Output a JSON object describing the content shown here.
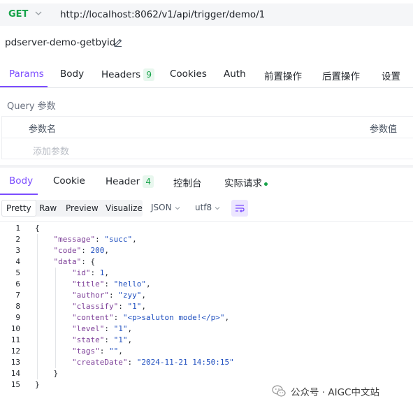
{
  "request": {
    "method": "GET",
    "url": "http://localhost:8062/v1/api/trigger/demo/1",
    "name": "pdserver-demo-getbyid"
  },
  "request_tabs": [
    {
      "label": "Params",
      "active": true
    },
    {
      "label": "Body"
    },
    {
      "label": "Headers",
      "badge": "9"
    },
    {
      "label": "Cookies"
    },
    {
      "label": "Auth"
    },
    {
      "label": "前置操作"
    },
    {
      "label": "后置操作"
    },
    {
      "label": "设置"
    }
  ],
  "query": {
    "section_label": "Query 参数",
    "name_header": "参数名",
    "value_header": "参数值",
    "add_placeholder": "添加参数"
  },
  "response_tabs": [
    {
      "label": "Body",
      "active": true
    },
    {
      "label": "Cookie"
    },
    {
      "label": "Header",
      "badge": "4"
    },
    {
      "label": "控制台"
    },
    {
      "label": "实际请求"
    }
  ],
  "format_toolbar": {
    "modes": [
      "Pretty",
      "Raw",
      "Preview",
      "Visualize"
    ],
    "active_mode": "Pretty",
    "language": "JSON",
    "encoding": "utf8"
  },
  "code_lines": [
    {
      "n": "1",
      "indent": 0,
      "parts": [
        [
          "p",
          "{"
        ]
      ]
    },
    {
      "n": "2",
      "indent": 1,
      "parts": [
        [
          "k",
          "\"message\""
        ],
        [
          "p",
          ": "
        ],
        [
          "s",
          "\"succ\""
        ],
        [
          "p",
          ","
        ]
      ]
    },
    {
      "n": "3",
      "indent": 1,
      "parts": [
        [
          "k",
          "\"code\""
        ],
        [
          "p",
          ": "
        ],
        [
          "n",
          "200"
        ],
        [
          "p",
          ","
        ]
      ]
    },
    {
      "n": "4",
      "indent": 1,
      "parts": [
        [
          "k",
          "\"data\""
        ],
        [
          "p",
          ": {"
        ]
      ]
    },
    {
      "n": "5",
      "indent": 2,
      "parts": [
        [
          "k",
          "\"id\""
        ],
        [
          "p",
          ": "
        ],
        [
          "n",
          "1"
        ],
        [
          "p",
          ","
        ]
      ]
    },
    {
      "n": "6",
      "indent": 2,
      "parts": [
        [
          "k",
          "\"title\""
        ],
        [
          "p",
          ": "
        ],
        [
          "s",
          "\"hello\""
        ],
        [
          "p",
          ","
        ]
      ]
    },
    {
      "n": "7",
      "indent": 2,
      "parts": [
        [
          "k",
          "\"author\""
        ],
        [
          "p",
          ": "
        ],
        [
          "s",
          "\"zyy\""
        ],
        [
          "p",
          ","
        ]
      ]
    },
    {
      "n": "8",
      "indent": 2,
      "parts": [
        [
          "k",
          "\"classify\""
        ],
        [
          "p",
          ": "
        ],
        [
          "s",
          "\"1\""
        ],
        [
          "p",
          ","
        ]
      ]
    },
    {
      "n": "9",
      "indent": 2,
      "parts": [
        [
          "k",
          "\"content\""
        ],
        [
          "p",
          ": "
        ],
        [
          "s",
          "\"<p>saluton mode!</p>\""
        ],
        [
          "p",
          ","
        ]
      ]
    },
    {
      "n": "10",
      "indent": 2,
      "parts": [
        [
          "k",
          "\"level\""
        ],
        [
          "p",
          ": "
        ],
        [
          "s",
          "\"1\""
        ],
        [
          "p",
          ","
        ]
      ]
    },
    {
      "n": "11",
      "indent": 2,
      "parts": [
        [
          "k",
          "\"state\""
        ],
        [
          "p",
          ": "
        ],
        [
          "s",
          "\"1\""
        ],
        [
          "p",
          ","
        ]
      ]
    },
    {
      "n": "12",
      "indent": 2,
      "parts": [
        [
          "k",
          "\"tags\""
        ],
        [
          "p",
          ": "
        ],
        [
          "s",
          "\"\""
        ],
        [
          "p",
          ","
        ]
      ]
    },
    {
      "n": "13",
      "indent": 2,
      "parts": [
        [
          "k",
          "\"createDate\""
        ],
        [
          "p",
          ": "
        ],
        [
          "s",
          "\"2024-11-21 14:50:15\""
        ]
      ]
    },
    {
      "n": "14",
      "indent": 1,
      "parts": [
        [
          "p",
          "}"
        ]
      ]
    },
    {
      "n": "15",
      "indent": 0,
      "parts": [
        [
          "p",
          "}"
        ]
      ]
    }
  ],
  "watermark": "公众号 · AIGC中文站",
  "colors": {
    "accent": "#7c4dff",
    "method_get": "#17a34a",
    "json_key": "#7d3f98",
    "json_value": "#1f4fbf"
  }
}
